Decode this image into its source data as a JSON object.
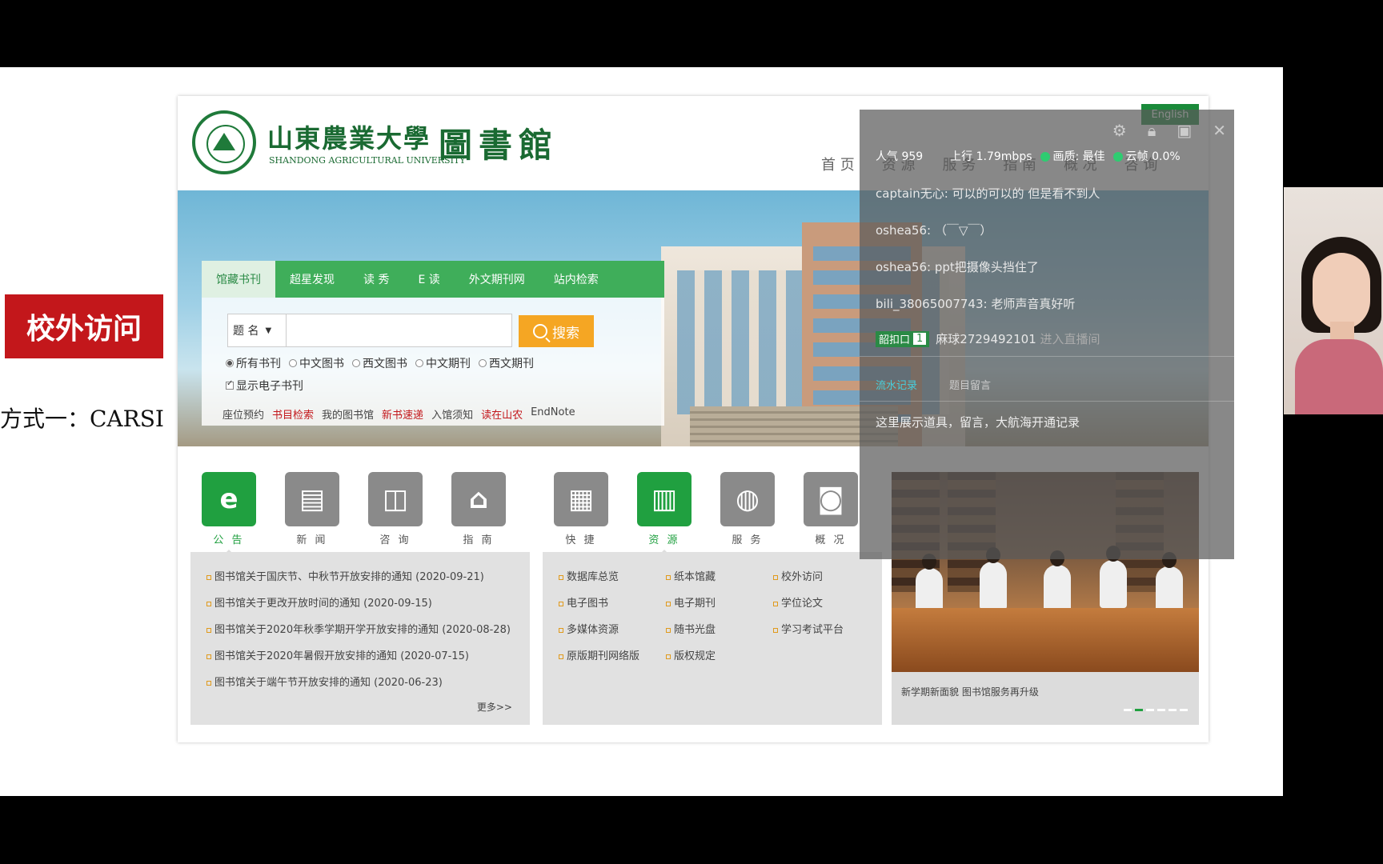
{
  "slide": {
    "red_label": "校外访问",
    "method_text": "方式一：CARSI"
  },
  "site": {
    "university_name": "山東農業大學",
    "university_en": "SHANDONG AGRICULTURAL UNIVERSITY",
    "library_name": "圖書館",
    "english_button": "English",
    "nav": [
      "首 页",
      "资 源",
      "服 务",
      "指 南",
      "概 况",
      "咨 询"
    ]
  },
  "search": {
    "tabs": [
      "馆藏书刊",
      "超星发现",
      "读 秀",
      "E 读",
      "外文期刊网",
      "站内检索"
    ],
    "field_value": "题  名",
    "button_label": "搜索",
    "radios": [
      "所有书刊",
      "中文图书",
      "西文图书",
      "中文期刊",
      "西文期刊"
    ],
    "ebook_label": "显示电子书刊",
    "quick_links": [
      "座位预约",
      "书目检索",
      "我的图书馆",
      "新书速递",
      "入馆须知",
      "读在山农",
      "EndNote"
    ]
  },
  "icons": [
    {
      "label": "公 告",
      "icon": "ie-icon"
    },
    {
      "label": "新 闻",
      "icon": "news-icon"
    },
    {
      "label": "咨 询",
      "icon": "book-icon"
    },
    {
      "label": "指 南",
      "icon": "building-icon"
    },
    {
      "label": "快 捷",
      "icon": "grid-icon"
    },
    {
      "label": "资 源",
      "icon": "books-icon"
    },
    {
      "label": "服 务",
      "icon": "globe-icon"
    },
    {
      "label": "概 况",
      "icon": "search-doc-icon"
    }
  ],
  "notices": [
    "图书馆关于国庆节、中秋节开放安排的通知 (2020-09-21)",
    "图书馆关于更改开放时间的通知 (2020-09-15)",
    "图书馆关于2020年秋季学期开学开放安排的通知 (2020-08-28)",
    "图书馆关于2020年暑假开放安排的通知 (2020-07-15)",
    "图书馆关于端午节开放安排的通知 (2020-06-23)"
  ],
  "notice_more": "更多>>",
  "resources": [
    [
      "数据库总览",
      "纸本馆藏",
      "校外访问"
    ],
    [
      "电子图书",
      "电子期刊",
      "学位论文"
    ],
    [
      "多媒体资源",
      "随书光盘",
      "学习考试平台"
    ],
    [
      "原版期刊网络版",
      "版权规定",
      ""
    ]
  ],
  "photo_caption": "新学期新面貌 图书馆服务再升级",
  "overlay": {
    "stats": {
      "popularity": "人气 959",
      "upload": "上行 1.79mbps",
      "quality": "画质: 最佳",
      "cloud": "云帧 0.0%"
    },
    "chat": [
      {
        "user": "captain无心:",
        "text": "可以的可以的 但是看不到人"
      },
      {
        "user": "oshea56:",
        "text": "（￣▽￣）"
      },
      {
        "user": "oshea56:",
        "text": "ppt把摄像头挡住了"
      },
      {
        "user": "bili_38065007743:",
        "text": "老师声音真好听"
      }
    ],
    "join": {
      "badge": "韶扣口",
      "level": "1",
      "user": "麻球2729492101",
      "text": "进入直播间"
    },
    "tabs": [
      "流水记录",
      "题目留言"
    ],
    "hint": "这里展示道具，留言，大航海开通记录"
  }
}
